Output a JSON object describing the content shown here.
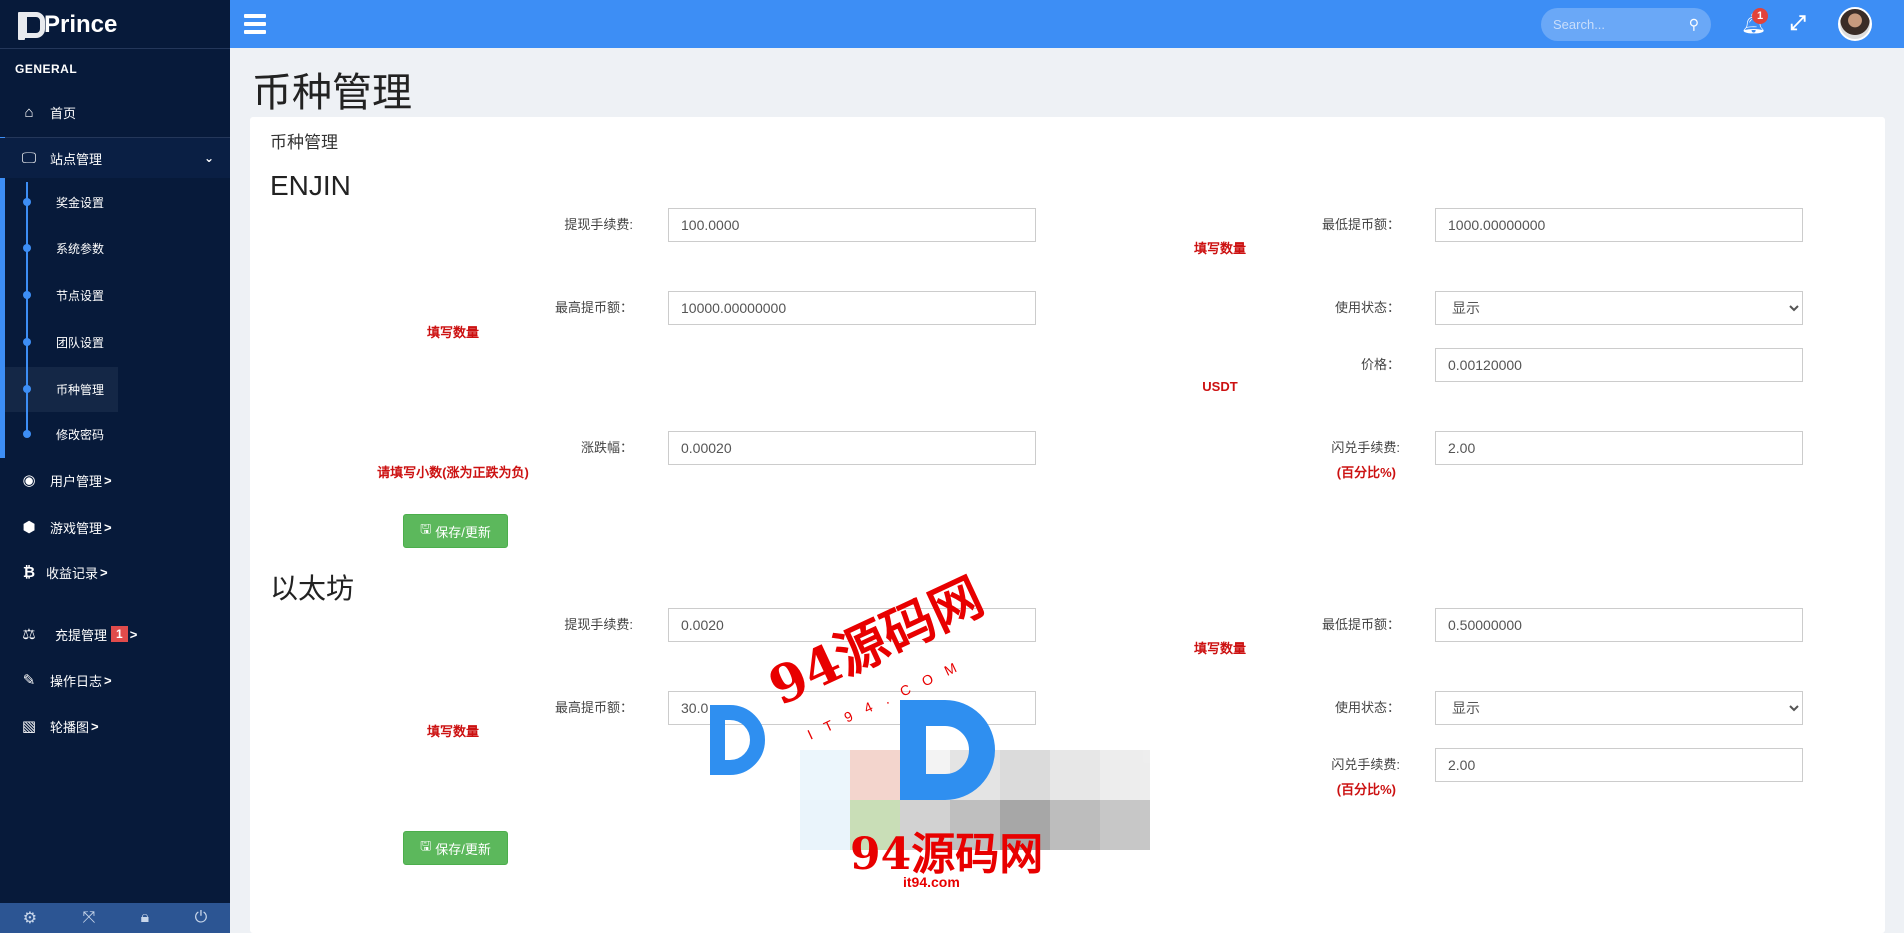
{
  "app": {
    "brand": "Prince",
    "logo_icon": "prince-p-logo"
  },
  "sidebar": {
    "section": "GENERAL",
    "home": {
      "label": "首页",
      "icon": "home-icon"
    },
    "site": {
      "label": "站点管理",
      "icon": "monitor-icon",
      "expanded": true,
      "items": [
        {
          "label": "奖金设置"
        },
        {
          "label": "系统参数"
        },
        {
          "label": "节点设置"
        },
        {
          "label": "团队设置"
        },
        {
          "label": "币种管理",
          "active": true
        },
        {
          "label": "修改密码"
        }
      ]
    },
    "menu": [
      {
        "label": "用户管理",
        "icon": "user-circle-icon"
      },
      {
        "label": "游戏管理",
        "icon": "cube-icon"
      },
      {
        "label": "收益记录",
        "icon": "bitcoin-icon"
      },
      {
        "label": "充提管理",
        "icon": "balance-scale-icon",
        "badge": "1"
      },
      {
        "label": "操作日志",
        "icon": "edit-icon"
      },
      {
        "label": "轮播图",
        "icon": "image-icon"
      }
    ],
    "chevron": ">",
    "footer_icons": [
      "gear-icon",
      "expand-icon",
      "lock-icon",
      "power-icon"
    ]
  },
  "header": {
    "search_placeholder": "Search...",
    "notification_count": "1"
  },
  "page": {
    "title": "币种管理",
    "card_title": "币种管理"
  },
  "colors": {
    "header": "#3d8ef5",
    "sidebar": "#071a3a",
    "button": "#5cb85c",
    "hint": "#cc1111"
  },
  "enjin": {
    "name": "ENJIN",
    "withdraw_fee": {
      "label": "提现手续费:",
      "value": "100.0000"
    },
    "min_withdraw": {
      "label": "最低提币额：",
      "value": "1000.00000000",
      "hint": "填写数量"
    },
    "max_withdraw": {
      "label": "最高提币额：",
      "value": "10000.00000000",
      "hint": "填写数量"
    },
    "status": {
      "label": "使用状态：",
      "value": "显示"
    },
    "price": {
      "label": "价格：",
      "value": "0.00120000",
      "hint": "USDT"
    },
    "change": {
      "label": "涨跌幅：",
      "value": "0.00020",
      "hint": "请填写小数(涨为正跌为负)"
    },
    "swap_fee": {
      "label": "闪兑手续费:",
      "value": "2.00",
      "hint": "(百分比%)"
    },
    "save": "保存/更新"
  },
  "eth": {
    "name": "以太坊",
    "withdraw_fee": {
      "label": "提现手续费:",
      "value": "0.0020"
    },
    "min_withdraw": {
      "label": "最低提币额：",
      "value": "0.50000000",
      "hint": "填写数量"
    },
    "max_withdraw": {
      "label": "最高提币额：",
      "value": "30.0",
      "hint": "填写数量"
    },
    "status": {
      "label": "使用状态：",
      "value": "显示"
    },
    "swap_fee": {
      "label": "闪兑手续费:",
      "value": "2.00",
      "hint": "(百分比%)"
    },
    "save": "保存/更新"
  },
  "watermark": {
    "text": "94源码网",
    "url": "it94.com",
    "arc": "IT94.COM"
  }
}
